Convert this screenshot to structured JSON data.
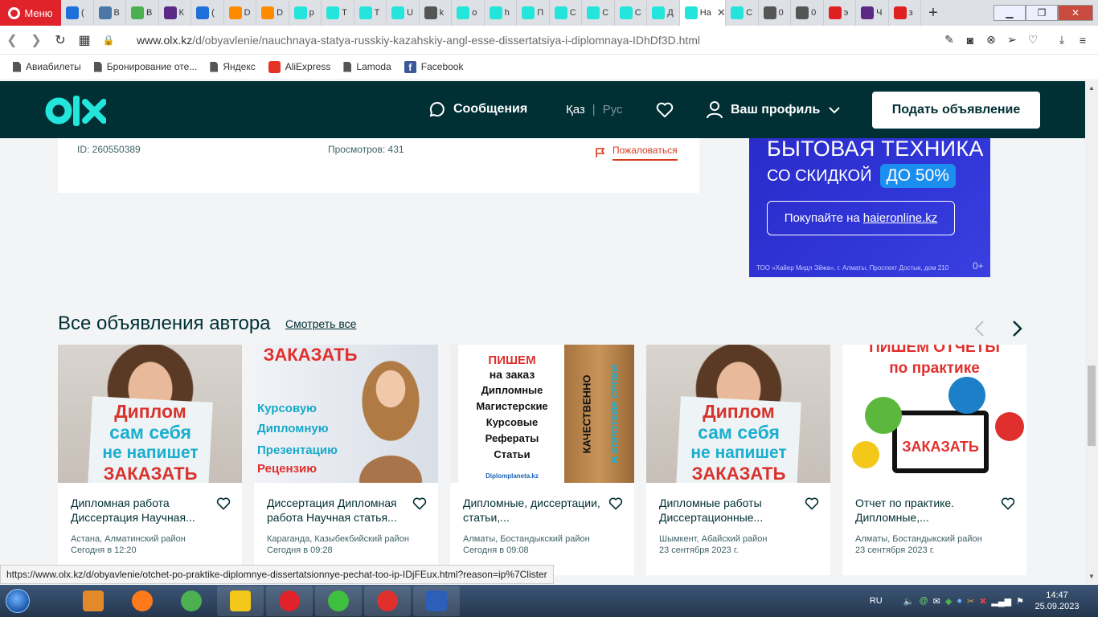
{
  "browser": {
    "menu_label": "Меню",
    "tabs": [
      {
        "label": "(",
        "icon": "mail-icon",
        "color": "#1e6fd9"
      },
      {
        "label": "В",
        "icon": "vk-icon",
        "color": "#4a76a8"
      },
      {
        "label": "В",
        "icon": "green-app-icon",
        "color": "#4caf50"
      },
      {
        "label": "К",
        "icon": "purple-app-icon",
        "color": "#5b2a86"
      },
      {
        "label": "(",
        "icon": "mail-icon",
        "color": "#1e6fd9"
      },
      {
        "label": "D",
        "icon": "cloud-icon",
        "color": "#ff8a00"
      },
      {
        "label": "D",
        "icon": "cloud-icon",
        "color": "#ff8a00"
      },
      {
        "label": "р",
        "icon": "olx-icon",
        "color": "#23e5db"
      },
      {
        "label": "Т",
        "icon": "olx-icon",
        "color": "#23e5db"
      },
      {
        "label": "Т",
        "icon": "olx-icon",
        "color": "#23e5db"
      },
      {
        "label": "U",
        "icon": "olx-icon",
        "color": "#23e5db"
      },
      {
        "label": "k",
        "icon": "globe-icon",
        "color": "#555555"
      },
      {
        "label": "о",
        "icon": "olx-icon",
        "color": "#23e5db"
      },
      {
        "label": "h",
        "icon": "olx-icon",
        "color": "#23e5db"
      },
      {
        "label": "П",
        "icon": "olx-icon",
        "color": "#23e5db"
      },
      {
        "label": "С",
        "icon": "olx-icon",
        "color": "#23e5db"
      },
      {
        "label": "С",
        "icon": "olx-icon",
        "color": "#23e5db"
      },
      {
        "label": "С",
        "icon": "olx-icon",
        "color": "#23e5db"
      },
      {
        "label": "Д",
        "icon": "olx-icon",
        "color": "#23e5db"
      },
      {
        "label": "На",
        "icon": "olx-icon",
        "color": "#23e5db",
        "active": true
      },
      {
        "label": "С",
        "icon": "olx-icon",
        "color": "#23e5db"
      },
      {
        "label": "0",
        "icon": "globe-icon",
        "color": "#555555"
      },
      {
        "label": "0",
        "icon": "globe-icon",
        "color": "#555555"
      },
      {
        "label": "э",
        "icon": "yandex-icon",
        "color": "#e02020"
      },
      {
        "label": "Ч",
        "icon": "purple-app-icon",
        "color": "#5b2a86"
      },
      {
        "label": "з",
        "icon": "yandex-icon",
        "color": "#e02020"
      }
    ],
    "url_host": "www.olx.kz",
    "url_path": "/d/obyavlenie/nauchnaya-statya-russkiy-kazahskiy-angl-esse-dissertatsiya-i-diplomnaya-IDhDf3D.html",
    "bookmarks": [
      {
        "label": "Авиабилеты",
        "icon": "doc-icon"
      },
      {
        "label": "Бронирование оте...",
        "icon": "doc-icon"
      },
      {
        "label": "Яндекс",
        "icon": "doc-icon"
      },
      {
        "label": "AliExpress",
        "icon": "aliexpress-icon"
      },
      {
        "label": "Lamoda",
        "icon": "doc-icon"
      },
      {
        "label": "Facebook",
        "icon": "facebook-icon"
      }
    ],
    "status_url": "https://www.olx.kz/d/obyavlenie/otchet-po-praktike-diplomnye-dissertatsionnye-pechat-too-ip-IDjFEux.html?reason=ip%7Clister"
  },
  "olx_header": {
    "messages_label": "Сообщения",
    "lang_kz": "Қаз",
    "lang_sep": "|",
    "lang_ru": "Рус",
    "profile_label": "Ваш профиль",
    "post_button": "Подать объявление",
    "brand_color": "#002f34",
    "accent_color": "#23e5db"
  },
  "ad_info": {
    "id_text": "ID: 260550389",
    "views_text": "Просмотров: 431",
    "report_label": "Пожаловаться"
  },
  "banner": {
    "line1": "БЫТОВАЯ ТЕХНИКА",
    "line2": "СО СКИДКОЙ",
    "discount": "ДО 50%",
    "cta_prefix": "Покупайте на",
    "cta_link": "haieronline.kz",
    "legal": "ТОО «Хайер Мидл Эйжа», г. Алматы, Проспект Достык, дом 210",
    "age": "0+"
  },
  "author_section": {
    "title": "Все объявления автора",
    "see_all": "Смотреть все",
    "cards": [
      {
        "title": "Дипломная работа Диссертация Научная...",
        "location": "Астана, Алматинский район",
        "date": "Сегодня в 12:20",
        "image_text": [
          "Диплом",
          "сам себя",
          "не напишет",
          "ЗАКАЗАТЬ"
        ]
      },
      {
        "title": "Диссертация Дипломная работа Научная статья...",
        "location": "Караганда, Казыбекбийский район",
        "date": "Сегодня в 09:28",
        "image_text": [
          "ЗАКАЗАТЬ",
          "Курсовую",
          "Дипломную",
          "Презентацию",
          "Рецензию"
        ]
      },
      {
        "title": "Дипломные, диссертации, статьи,...",
        "location": "Алматы, Бостандыкский район",
        "date": "Сегодня в 09:08",
        "image_text": [
          "ПИШЕМ",
          "на заказ",
          "Дипломные",
          "Магистерские",
          "Курсовые",
          "Рефераты",
          "Статьи",
          "КАЧЕСТВЕННО",
          "В КОРОТКИЕ СРОКИ",
          "Diplomplaneta.kz"
        ]
      },
      {
        "title": "Дипломные работы Диссертационные...",
        "location": "Шымкент, Абайский район",
        "date": "23 сентября 2023 г.",
        "image_text": [
          "Диплом",
          "сам себя",
          "не напишет",
          "ЗАКАЗАТЬ"
        ]
      },
      {
        "title": "Отчет по практике. Дипломные,...",
        "location": "Алматы, Бостандыкский район",
        "date": "23 сентября 2023 г.",
        "image_text": [
          "ПИШЕМ ОТЧЕТЫ",
          "по практике",
          "ЗАКАЗАТЬ"
        ]
      }
    ]
  },
  "taskbar": {
    "apps": [
      "media-player-icon",
      "firefox-icon",
      "chrome-icon",
      "file-explorer-icon",
      "opera-icon",
      "agent-icon",
      "yandex-browser-icon",
      "word-icon"
    ],
    "lang": "RU",
    "time": "14:47",
    "date": "25.09.2023"
  }
}
